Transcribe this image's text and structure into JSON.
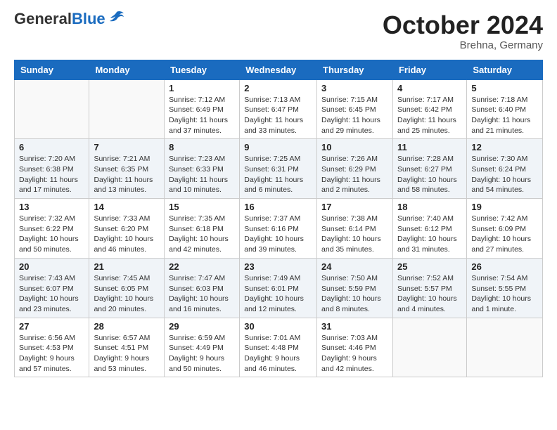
{
  "header": {
    "logo_general": "General",
    "logo_blue": "Blue",
    "month_year": "October 2024",
    "location": "Brehna, Germany"
  },
  "days_of_week": [
    "Sunday",
    "Monday",
    "Tuesday",
    "Wednesday",
    "Thursday",
    "Friday",
    "Saturday"
  ],
  "weeks": [
    [
      {
        "day": "",
        "detail": ""
      },
      {
        "day": "",
        "detail": ""
      },
      {
        "day": "1",
        "detail": "Sunrise: 7:12 AM\nSunset: 6:49 PM\nDaylight: 11 hours\nand 37 minutes."
      },
      {
        "day": "2",
        "detail": "Sunrise: 7:13 AM\nSunset: 6:47 PM\nDaylight: 11 hours\nand 33 minutes."
      },
      {
        "day": "3",
        "detail": "Sunrise: 7:15 AM\nSunset: 6:45 PM\nDaylight: 11 hours\nand 29 minutes."
      },
      {
        "day": "4",
        "detail": "Sunrise: 7:17 AM\nSunset: 6:42 PM\nDaylight: 11 hours\nand 25 minutes."
      },
      {
        "day": "5",
        "detail": "Sunrise: 7:18 AM\nSunset: 6:40 PM\nDaylight: 11 hours\nand 21 minutes."
      }
    ],
    [
      {
        "day": "6",
        "detail": "Sunrise: 7:20 AM\nSunset: 6:38 PM\nDaylight: 11 hours\nand 17 minutes."
      },
      {
        "day": "7",
        "detail": "Sunrise: 7:21 AM\nSunset: 6:35 PM\nDaylight: 11 hours\nand 13 minutes."
      },
      {
        "day": "8",
        "detail": "Sunrise: 7:23 AM\nSunset: 6:33 PM\nDaylight: 11 hours\nand 10 minutes."
      },
      {
        "day": "9",
        "detail": "Sunrise: 7:25 AM\nSunset: 6:31 PM\nDaylight: 11 hours\nand 6 minutes."
      },
      {
        "day": "10",
        "detail": "Sunrise: 7:26 AM\nSunset: 6:29 PM\nDaylight: 11 hours\nand 2 minutes."
      },
      {
        "day": "11",
        "detail": "Sunrise: 7:28 AM\nSunset: 6:27 PM\nDaylight: 10 hours\nand 58 minutes."
      },
      {
        "day": "12",
        "detail": "Sunrise: 7:30 AM\nSunset: 6:24 PM\nDaylight: 10 hours\nand 54 minutes."
      }
    ],
    [
      {
        "day": "13",
        "detail": "Sunrise: 7:32 AM\nSunset: 6:22 PM\nDaylight: 10 hours\nand 50 minutes."
      },
      {
        "day": "14",
        "detail": "Sunrise: 7:33 AM\nSunset: 6:20 PM\nDaylight: 10 hours\nand 46 minutes."
      },
      {
        "day": "15",
        "detail": "Sunrise: 7:35 AM\nSunset: 6:18 PM\nDaylight: 10 hours\nand 42 minutes."
      },
      {
        "day": "16",
        "detail": "Sunrise: 7:37 AM\nSunset: 6:16 PM\nDaylight: 10 hours\nand 39 minutes."
      },
      {
        "day": "17",
        "detail": "Sunrise: 7:38 AM\nSunset: 6:14 PM\nDaylight: 10 hours\nand 35 minutes."
      },
      {
        "day": "18",
        "detail": "Sunrise: 7:40 AM\nSunset: 6:12 PM\nDaylight: 10 hours\nand 31 minutes."
      },
      {
        "day": "19",
        "detail": "Sunrise: 7:42 AM\nSunset: 6:09 PM\nDaylight: 10 hours\nand 27 minutes."
      }
    ],
    [
      {
        "day": "20",
        "detail": "Sunrise: 7:43 AM\nSunset: 6:07 PM\nDaylight: 10 hours\nand 23 minutes."
      },
      {
        "day": "21",
        "detail": "Sunrise: 7:45 AM\nSunset: 6:05 PM\nDaylight: 10 hours\nand 20 minutes."
      },
      {
        "day": "22",
        "detail": "Sunrise: 7:47 AM\nSunset: 6:03 PM\nDaylight: 10 hours\nand 16 minutes."
      },
      {
        "day": "23",
        "detail": "Sunrise: 7:49 AM\nSunset: 6:01 PM\nDaylight: 10 hours\nand 12 minutes."
      },
      {
        "day": "24",
        "detail": "Sunrise: 7:50 AM\nSunset: 5:59 PM\nDaylight: 10 hours\nand 8 minutes."
      },
      {
        "day": "25",
        "detail": "Sunrise: 7:52 AM\nSunset: 5:57 PM\nDaylight: 10 hours\nand 4 minutes."
      },
      {
        "day": "26",
        "detail": "Sunrise: 7:54 AM\nSunset: 5:55 PM\nDaylight: 10 hours\nand 1 minute."
      }
    ],
    [
      {
        "day": "27",
        "detail": "Sunrise: 6:56 AM\nSunset: 4:53 PM\nDaylight: 9 hours\nand 57 minutes."
      },
      {
        "day": "28",
        "detail": "Sunrise: 6:57 AM\nSunset: 4:51 PM\nDaylight: 9 hours\nand 53 minutes."
      },
      {
        "day": "29",
        "detail": "Sunrise: 6:59 AM\nSunset: 4:49 PM\nDaylight: 9 hours\nand 50 minutes."
      },
      {
        "day": "30",
        "detail": "Sunrise: 7:01 AM\nSunset: 4:48 PM\nDaylight: 9 hours\nand 46 minutes."
      },
      {
        "day": "31",
        "detail": "Sunrise: 7:03 AM\nSunset: 4:46 PM\nDaylight: 9 hours\nand 42 minutes."
      },
      {
        "day": "",
        "detail": ""
      },
      {
        "day": "",
        "detail": ""
      }
    ]
  ]
}
